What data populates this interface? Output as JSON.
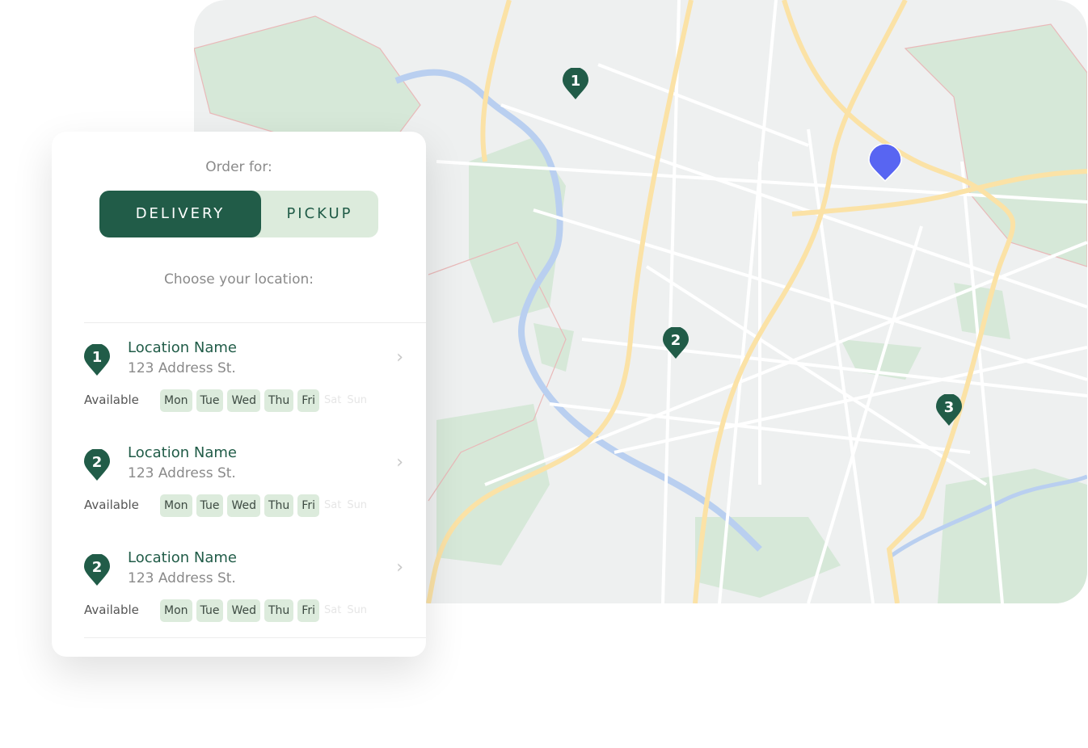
{
  "order": {
    "label": "Order for:",
    "options": [
      "DELIVERY",
      "PICKUP"
    ],
    "selected": "DELIVERY"
  },
  "choose_label": "Choose your location:",
  "locations": [
    {
      "number": "1",
      "name": "Location Name",
      "address": "123 Address St.",
      "available_label": "Available",
      "days_on": [
        "Mon",
        "Tue",
        "Wed",
        "Thu",
        "Fri"
      ],
      "days_off": [
        "Sat",
        "Sun"
      ]
    },
    {
      "number": "2",
      "name": "Location Name",
      "address": "123 Address St.",
      "available_label": "Available",
      "days_on": [
        "Mon",
        "Tue",
        "Wed",
        "Thu",
        "Fri"
      ],
      "days_off": [
        "Sat",
        "Sun"
      ]
    },
    {
      "number": "2",
      "name": "Location Name",
      "address": "123 Address St.",
      "available_label": "Available",
      "days_on": [
        "Mon",
        "Tue",
        "Wed",
        "Thu",
        "Fri"
      ],
      "days_off": [
        "Sat",
        "Sun"
      ]
    }
  ],
  "map": {
    "markers": [
      "1",
      "2",
      "3"
    ],
    "user_marker_icon": "location-pin-icon"
  },
  "colors": {
    "brand": "#215c48",
    "brand_light": "#dcebdc",
    "user_pin": "#5865f2"
  }
}
